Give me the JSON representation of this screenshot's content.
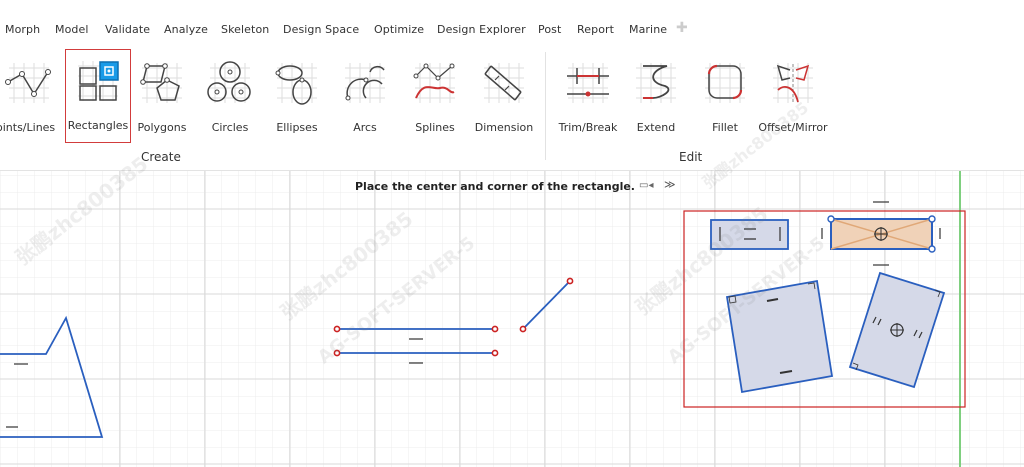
{
  "menu": [
    "Morph",
    "Model",
    "Validate",
    "Analyze",
    "Skeleton",
    "Design Space",
    "Optimize",
    "Design Explorer",
    "Post",
    "Report",
    "Marine"
  ],
  "ribbon": {
    "create_tools": [
      "oints/Lines",
      "Rectangles",
      "Polygons",
      "Circles",
      "Ellipses",
      "Arcs",
      "Splines",
      "Dimension"
    ],
    "edit_tools": [
      "Trim/Break",
      "Extend",
      "Fillet",
      "Offset/Mirror"
    ],
    "create_group": "Create",
    "edit_group": "Edit",
    "active_tool": "Rectangles",
    "accent": "#1a9be8"
  },
  "prompt": "Place the center and corner of the rectangle.",
  "watermark": [
    "张鹏zhc800385",
    "AG-SOFT-SERVER-5"
  ],
  "colors": {
    "sketch_line": "#2a5fbf",
    "sketch_fill": "#d5d9e8",
    "point": "#cc2222",
    "highlight_box": "#cc2222",
    "grid": "#e6e6e6",
    "green_axis": "#7fcf7f"
  }
}
